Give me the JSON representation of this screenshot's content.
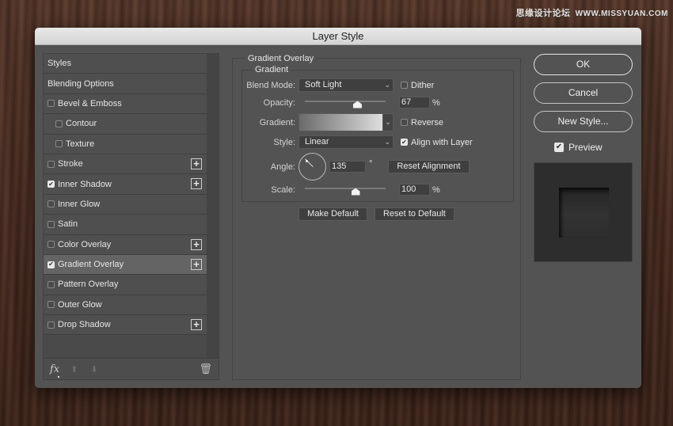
{
  "watermark": {
    "text": "思缘设计论坛",
    "url": "WWW.MISSYUAN.COM"
  },
  "dialog": {
    "title": "Layer Style"
  },
  "sidebar": {
    "items": [
      {
        "label": "Styles",
        "has_checkbox": false,
        "checked": false,
        "sub": false,
        "plus": false,
        "selected": false
      },
      {
        "label": "Blending Options",
        "has_checkbox": false,
        "checked": false,
        "sub": false,
        "plus": false,
        "selected": false
      },
      {
        "label": "Bevel & Emboss",
        "has_checkbox": true,
        "checked": false,
        "sub": false,
        "plus": false,
        "selected": false
      },
      {
        "label": "Contour",
        "has_checkbox": true,
        "checked": false,
        "sub": true,
        "plus": false,
        "selected": false
      },
      {
        "label": "Texture",
        "has_checkbox": true,
        "checked": false,
        "sub": true,
        "plus": false,
        "selected": false
      },
      {
        "label": "Stroke",
        "has_checkbox": true,
        "checked": false,
        "sub": false,
        "plus": true,
        "selected": false
      },
      {
        "label": "Inner Shadow",
        "has_checkbox": true,
        "checked": true,
        "sub": false,
        "plus": true,
        "selected": false
      },
      {
        "label": "Inner Glow",
        "has_checkbox": true,
        "checked": false,
        "sub": false,
        "plus": false,
        "selected": false
      },
      {
        "label": "Satin",
        "has_checkbox": true,
        "checked": false,
        "sub": false,
        "plus": false,
        "selected": false
      },
      {
        "label": "Color Overlay",
        "has_checkbox": true,
        "checked": false,
        "sub": false,
        "plus": true,
        "selected": false
      },
      {
        "label": "Gradient Overlay",
        "has_checkbox": true,
        "checked": true,
        "sub": false,
        "plus": true,
        "selected": true
      },
      {
        "label": "Pattern Overlay",
        "has_checkbox": true,
        "checked": false,
        "sub": false,
        "plus": false,
        "selected": false
      },
      {
        "label": "Outer Glow",
        "has_checkbox": true,
        "checked": false,
        "sub": false,
        "plus": false,
        "selected": false
      },
      {
        "label": "Drop Shadow",
        "has_checkbox": true,
        "checked": false,
        "sub": false,
        "plus": true,
        "selected": false
      }
    ],
    "footer": {
      "fx_label": "fx",
      "move_up": "move-up-icon",
      "move_down": "move-down-icon",
      "delete": "trash-icon"
    }
  },
  "panel": {
    "section_title": "Gradient Overlay",
    "group_title": "Gradient",
    "blend_mode": {
      "label": "Blend Mode:",
      "value": "Soft Light"
    },
    "dither": {
      "label": "Dither",
      "checked": false
    },
    "opacity": {
      "label": "Opacity:",
      "value": "67",
      "unit": "%",
      "percent": 67
    },
    "gradient": {
      "label": "Gradient:",
      "from": "#6a6a6a",
      "to": "#dedede"
    },
    "reverse": {
      "label": "Reverse",
      "checked": false
    },
    "style": {
      "label": "Style:",
      "value": "Linear"
    },
    "align_with_layer": {
      "label": "Align with Layer",
      "checked": true
    },
    "angle": {
      "label": "Angle:",
      "value": "135",
      "unit": "°",
      "degrees": 135
    },
    "reset_alignment": "Reset Alignment",
    "scale": {
      "label": "Scale:",
      "value": "100",
      "unit": "%",
      "percent": 100,
      "min": 10,
      "max": 150
    },
    "make_default": "Make Default",
    "reset_to_default": "Reset to Default"
  },
  "actions": {
    "ok": "OK",
    "cancel": "Cancel",
    "new_style": "New Style...",
    "preview": {
      "label": "Preview",
      "checked": true
    }
  }
}
